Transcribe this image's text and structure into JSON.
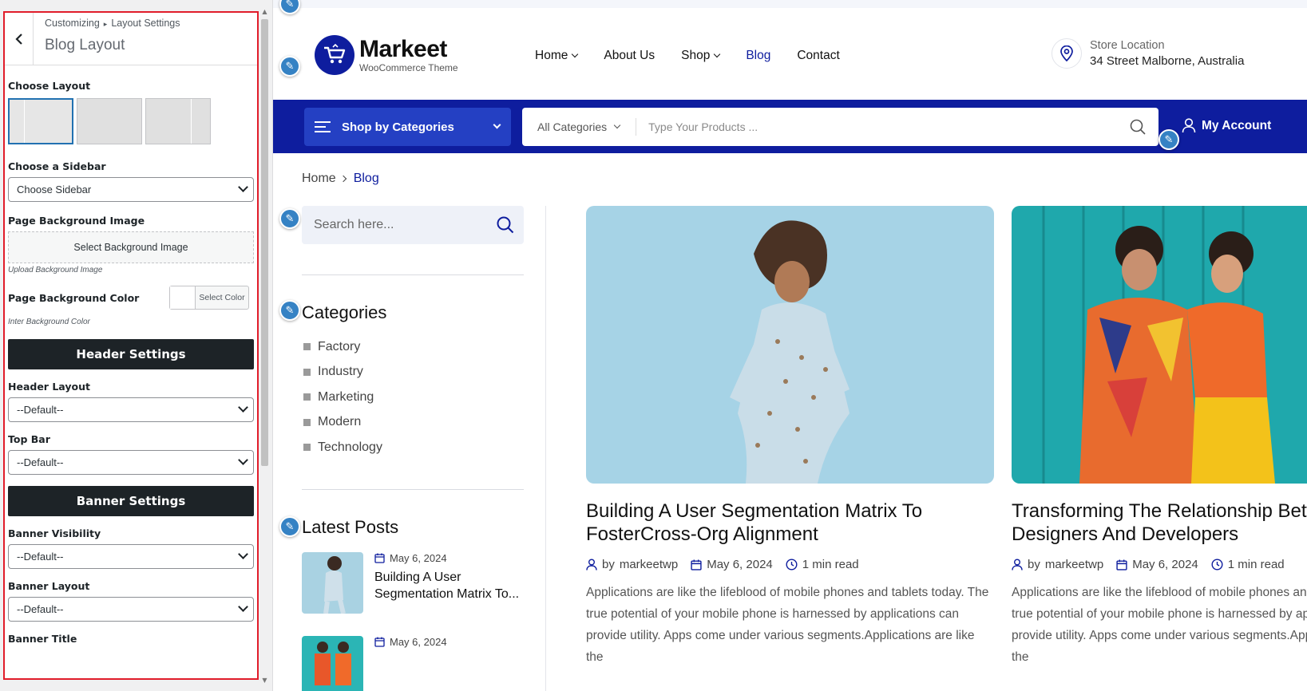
{
  "customizer": {
    "breadcrumb": [
      "Customizing",
      "Layout Settings"
    ],
    "title": "Blog Layout",
    "choose_layout_label": "Choose Layout",
    "sidebar_label": "Choose a Sidebar",
    "sidebar_value": "Choose Sidebar",
    "bg_image_label": "Page Background Image",
    "bg_image_button": "Select Background Image",
    "bg_image_help": "Upload Background Image",
    "bg_color_label": "Page Background Color",
    "bg_color_button": "Select Color",
    "bg_color_help": "Inter Background Color",
    "header_section": "Header Settings",
    "header_layout_label": "Header Layout",
    "header_layout_value": "--Default--",
    "top_bar_label": "Top Bar",
    "top_bar_value": "--Default--",
    "banner_section": "Banner Settings",
    "banner_visibility_label": "Banner Visibility",
    "banner_visibility_value": "--Default--",
    "banner_layout_label": "Banner Layout",
    "banner_layout_value": "--Default--",
    "banner_title_label": "Banner Title"
  },
  "site": {
    "logo_name": "Markeet",
    "logo_sub": "WooCommerce Theme",
    "nav": [
      "Home",
      "About Us",
      "Shop",
      "Blog",
      "Contact"
    ],
    "store_label": "Store Location",
    "store_address": "34 Street Malborne, Australia",
    "shop_by_categories": "Shop by Categories",
    "all_categories": "All Categories",
    "search_placeholder": "Type Your Products ...",
    "my_account": "My Account",
    "breadcrumb_home": "Home",
    "breadcrumb_current": "Blog",
    "sidebar_search_placeholder": "Search here...",
    "categories_heading": "Categories",
    "categories": [
      "Factory",
      "Industry",
      "Marketing",
      "Modern",
      "Technology"
    ],
    "latest_posts_heading": "Latest Posts",
    "latest_posts": [
      {
        "date": "May 6, 2024",
        "title": "Building A User Segmentation Matrix To..."
      },
      {
        "date": "May 6, 2024",
        "title": ""
      }
    ],
    "posts": [
      {
        "title": "Building A User Segmentation Matrix To FosterCross-Org Alignment",
        "by": "by",
        "author": "markeetwp",
        "date": "May 6, 2024",
        "read": "1 min read",
        "excerpt": "Applications are like the lifeblood of mobile phones and tablets today. The true potential of your mobile phone is harnessed by applications can provide utility. Apps come under various segments.Applications are like the"
      },
      {
        "title": "Transforming The Relationship Between Designers And Developers",
        "by": "by",
        "author": "markeetwp",
        "date": "May 6, 2024",
        "read": "1 min read",
        "excerpt": "Applications are like the lifeblood of mobile phones and tablets today. The true potential of your mobile phone is harnessed by applications can provide utility. Apps come under various segments.Applications are like the"
      }
    ]
  },
  "colors": {
    "brand_blue": "#0e1d9e",
    "button_blue": "#2440c3",
    "highlight_red": "#e11d2a",
    "edit_pin": "#3582c4"
  }
}
